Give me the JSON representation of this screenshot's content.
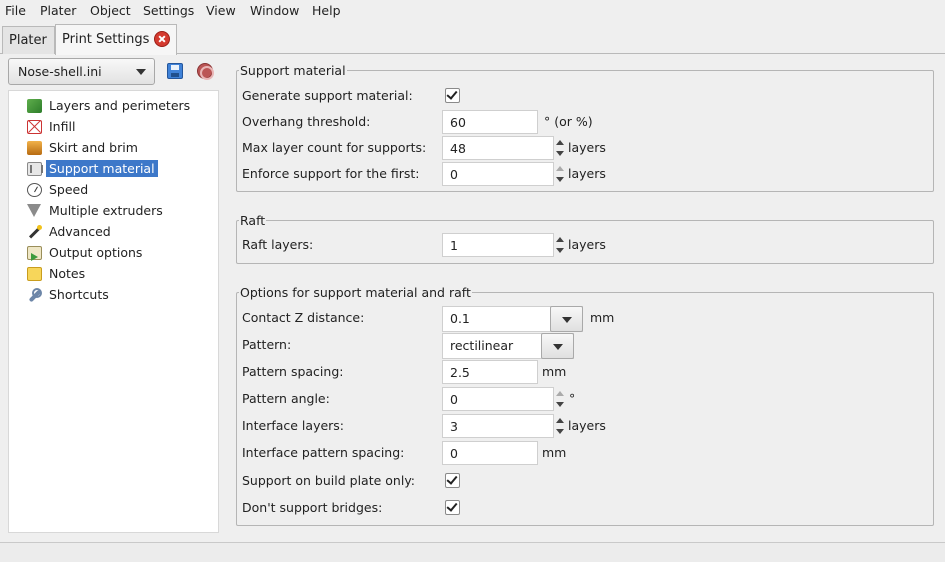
{
  "menubar": {
    "items": [
      "File",
      "Plater",
      "Object",
      "Settings",
      "View",
      "Window",
      "Help"
    ]
  },
  "tabs": [
    {
      "label": "Plater",
      "active": false
    },
    {
      "label": "Print Settings",
      "active": true
    }
  ],
  "preset": {
    "selected": "Nose-shell.ini"
  },
  "sidebar": {
    "items": [
      {
        "label": "Layers and perimeters",
        "icon": "layers-icon",
        "selected": false
      },
      {
        "label": "Infill",
        "icon": "infill-icon",
        "selected": false
      },
      {
        "label": "Skirt and brim",
        "icon": "skirt-icon",
        "selected": false
      },
      {
        "label": "Support material",
        "icon": "support-icon",
        "selected": true
      },
      {
        "label": "Speed",
        "icon": "speed-icon",
        "selected": false
      },
      {
        "label": "Multiple extruders",
        "icon": "funnel-icon",
        "selected": false
      },
      {
        "label": "Advanced",
        "icon": "wand-icon",
        "selected": false
      },
      {
        "label": "Output options",
        "icon": "output-icon",
        "selected": false
      },
      {
        "label": "Notes",
        "icon": "notes-icon",
        "selected": false
      },
      {
        "label": "Shortcuts",
        "icon": "wrench-icon",
        "selected": false
      }
    ]
  },
  "support_group": {
    "title": "Support material",
    "generate": {
      "label": "Generate support material:",
      "checked": true
    },
    "overhang": {
      "label": "Overhang threshold:",
      "value": "60",
      "unit": "° (or %)"
    },
    "max_layer": {
      "label": "Max layer count for supports:",
      "value": "48",
      "unit": "layers"
    },
    "enforce": {
      "label": "Enforce support for the first:",
      "value": "0",
      "unit": "layers"
    }
  },
  "raft_group": {
    "title": "Raft",
    "raft_layers": {
      "label": "Raft layers:",
      "value": "1",
      "unit": "layers"
    }
  },
  "options_group": {
    "title": "Options for support material and raft",
    "contact_z": {
      "label": "Contact Z distance:",
      "value": "0.1",
      "unit": "mm"
    },
    "pattern": {
      "label": "Pattern:",
      "value": "rectilinear"
    },
    "pattern_spacing": {
      "label": "Pattern spacing:",
      "value": "2.5",
      "unit": "mm"
    },
    "pattern_angle": {
      "label": "Pattern angle:",
      "value": "0",
      "unit": "°"
    },
    "interface_layers": {
      "label": "Interface layers:",
      "value": "3",
      "unit": "layers"
    },
    "interface_spacing": {
      "label": "Interface pattern spacing:",
      "value": "0",
      "unit": "mm"
    },
    "build_plate_only": {
      "label": "Support on build plate only:",
      "checked": true
    },
    "dont_support_bridges": {
      "label": "Don't support bridges:",
      "checked": true
    }
  },
  "colors": {
    "selection": "#3d78c9",
    "close_button": "#d43a2f"
  }
}
